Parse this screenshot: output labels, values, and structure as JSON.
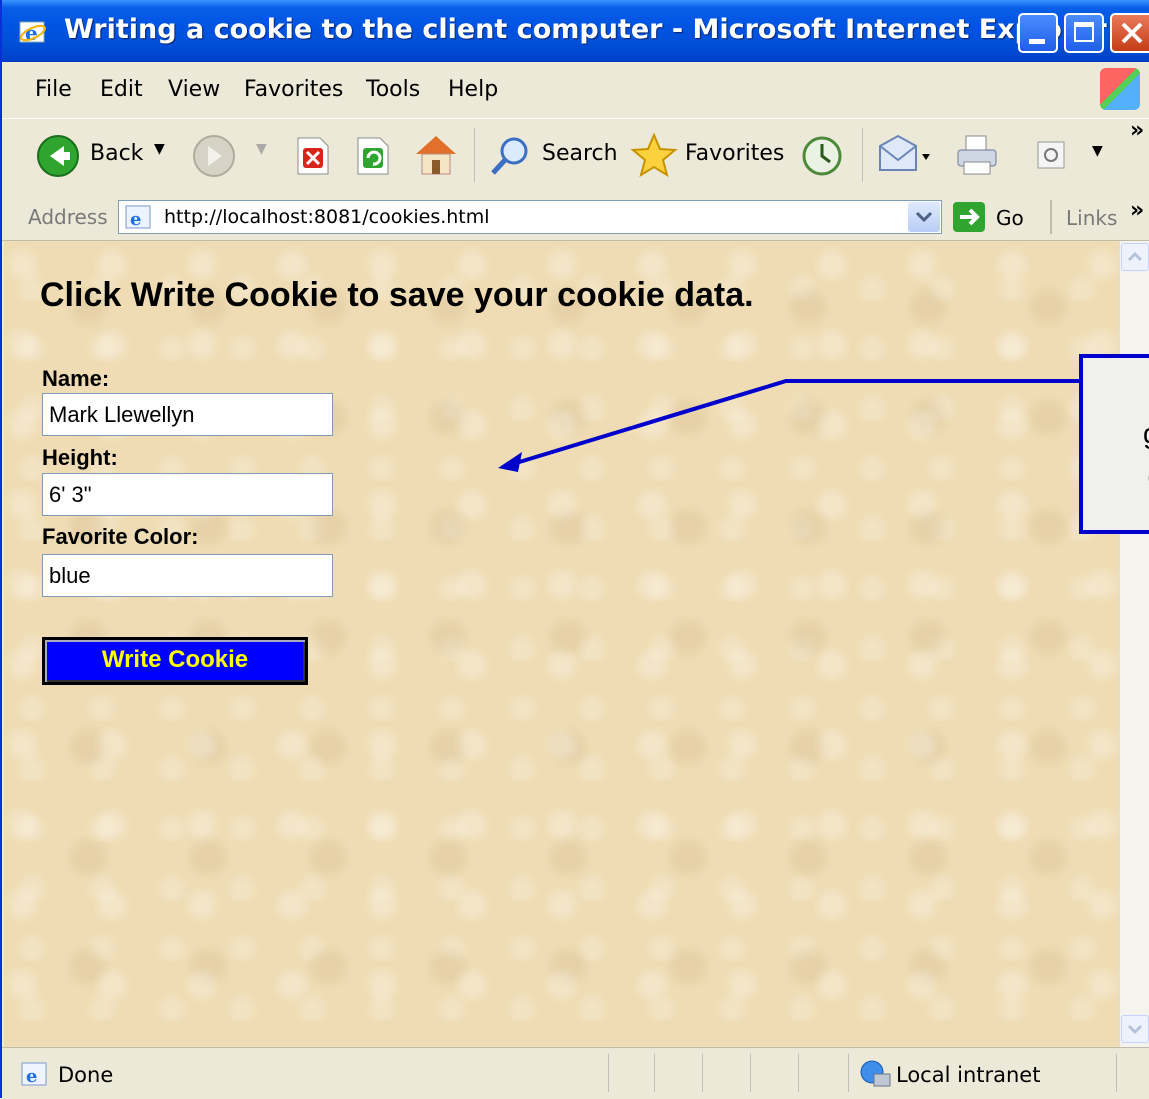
{
  "window": {
    "title": "Writing a cookie to the client computer - Microsoft Internet Explorer"
  },
  "menu": {
    "items": [
      "File",
      "Edit",
      "View",
      "Favorites",
      "Tools",
      "Help"
    ]
  },
  "toolbar": {
    "back_label": "Back",
    "search_label": "Search",
    "favorites_label": "Favorites",
    "overflow": "»"
  },
  "address": {
    "label": "Address",
    "url": "http://localhost:8081/cookies.html",
    "go_label": "Go",
    "links_label": "Links",
    "links_overflow": "»"
  },
  "page": {
    "heading": "Click Write Cookie to save your cookie data.",
    "fields": [
      {
        "label": "Name:",
        "value": "Mark Llewellyn"
      },
      {
        "label": "Height:",
        "value": "6' 3\""
      },
      {
        "label": "Favorite Color:",
        "value": "blue"
      }
    ],
    "button_label": "Write Cookie"
  },
  "callout": {
    "line1": "g",
    "line2": "("
  },
  "status": {
    "text": "Done",
    "zone": "Local intranet"
  },
  "colors": {
    "titlebar": "#0054e3",
    "content_bg": "#efdcb4",
    "button_bg": "#0000ff",
    "button_text": "#ffff00",
    "callout_border": "#0000cc"
  }
}
